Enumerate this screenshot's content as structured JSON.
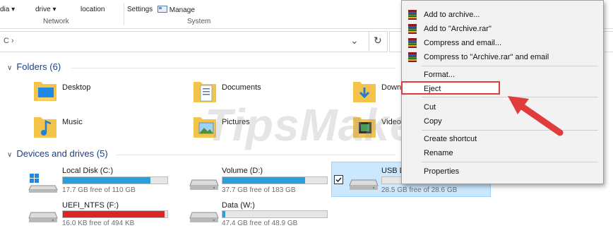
{
  "ribbon": {
    "items": [
      "dia ▾",
      "drive ▾",
      "location",
      "Settings",
      "Manage"
    ],
    "groups": [
      "Network",
      "System"
    ]
  },
  "address": {
    "path": "C ›",
    "dropdown": "⌄",
    "refresh": "↻"
  },
  "folders": {
    "heading": "Folders (6)",
    "items": [
      "Desktop",
      "Documents",
      "Down",
      "Music",
      "Pictures",
      "Videos"
    ]
  },
  "drives": {
    "heading": "Devices and drives (5)",
    "items": [
      {
        "name": "Local Disk (C:)",
        "free": "17.7 GB free of 110 GB",
        "used_fraction": 0.84,
        "color": "#26a0da"
      },
      {
        "name": "Volume (D:)",
        "free": "37.7 GB free of 183 GB",
        "used_fraction": 0.79,
        "color": "#26a0da"
      },
      {
        "name": "USB D",
        "free": "28.5 GB free of 28.6 GB",
        "used_fraction": 0.0,
        "color": "#26a0da"
      },
      {
        "name": "UEFI_NTFS (F:)",
        "free": "16.0 KB free of 494 KB",
        "used_fraction": 0.97,
        "color": "#da2626"
      },
      {
        "name": "Data (W:)",
        "free": "47.4 GB free of 48.9 GB",
        "used_fraction": 0.03,
        "color": "#26a0da"
      }
    ]
  },
  "context_menu": {
    "items": [
      {
        "label": "Add to archive...",
        "icon": "winrar-icon"
      },
      {
        "label": "Add to \"Archive.rar\"",
        "icon": "winrar-icon"
      },
      {
        "label": "Compress and email...",
        "icon": "winrar-icon"
      },
      {
        "label": "Compress to \"Archive.rar\" and email",
        "icon": "winrar-icon"
      },
      {
        "label": "Format...",
        "icon": ""
      },
      {
        "label": "Eject",
        "icon": ""
      },
      {
        "label": "Cut",
        "icon": ""
      },
      {
        "label": "Copy",
        "icon": ""
      },
      {
        "label": "Create shortcut",
        "icon": ""
      },
      {
        "label": "Rename",
        "icon": ""
      },
      {
        "label": "Properties",
        "icon": ""
      }
    ]
  },
  "highlight_color": "#e03c3c",
  "watermark": "TipsMake"
}
